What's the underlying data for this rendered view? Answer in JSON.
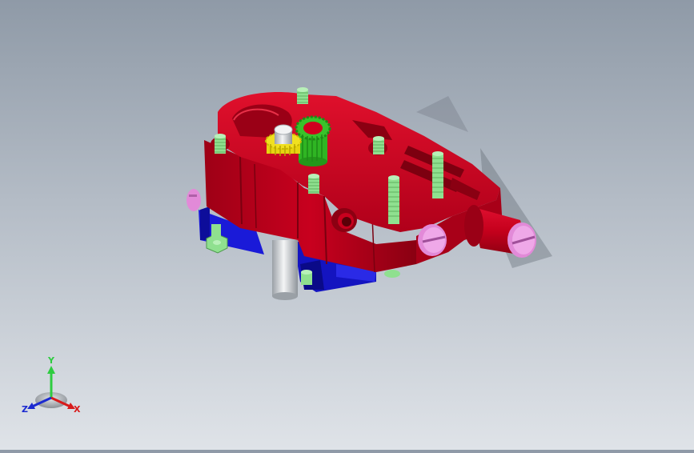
{
  "viewport": {
    "background_top": "#8f9aa7",
    "background_bottom": "#dfe3e8",
    "model": {
      "parts": [
        {
          "name": "housing-block",
          "color": "#c8001e"
        },
        {
          "name": "base-plate",
          "color": "#1a1ad8"
        },
        {
          "name": "driven-gear",
          "color": "#f0e020"
        },
        {
          "name": "drive-gear",
          "color": "#39c22a"
        },
        {
          "name": "slotted-screw",
          "color": "#e28ad8"
        },
        {
          "name": "set-screw",
          "color": "#8fe08f"
        },
        {
          "name": "dowel-pin",
          "color": "#c9ccd0"
        }
      ]
    }
  },
  "triad": {
    "y_label": "Y",
    "z_label": "Z",
    "x_label": "X",
    "y_color": "#2ecc40",
    "z_color": "#1b2ad0",
    "x_color": "#d81b1b"
  }
}
